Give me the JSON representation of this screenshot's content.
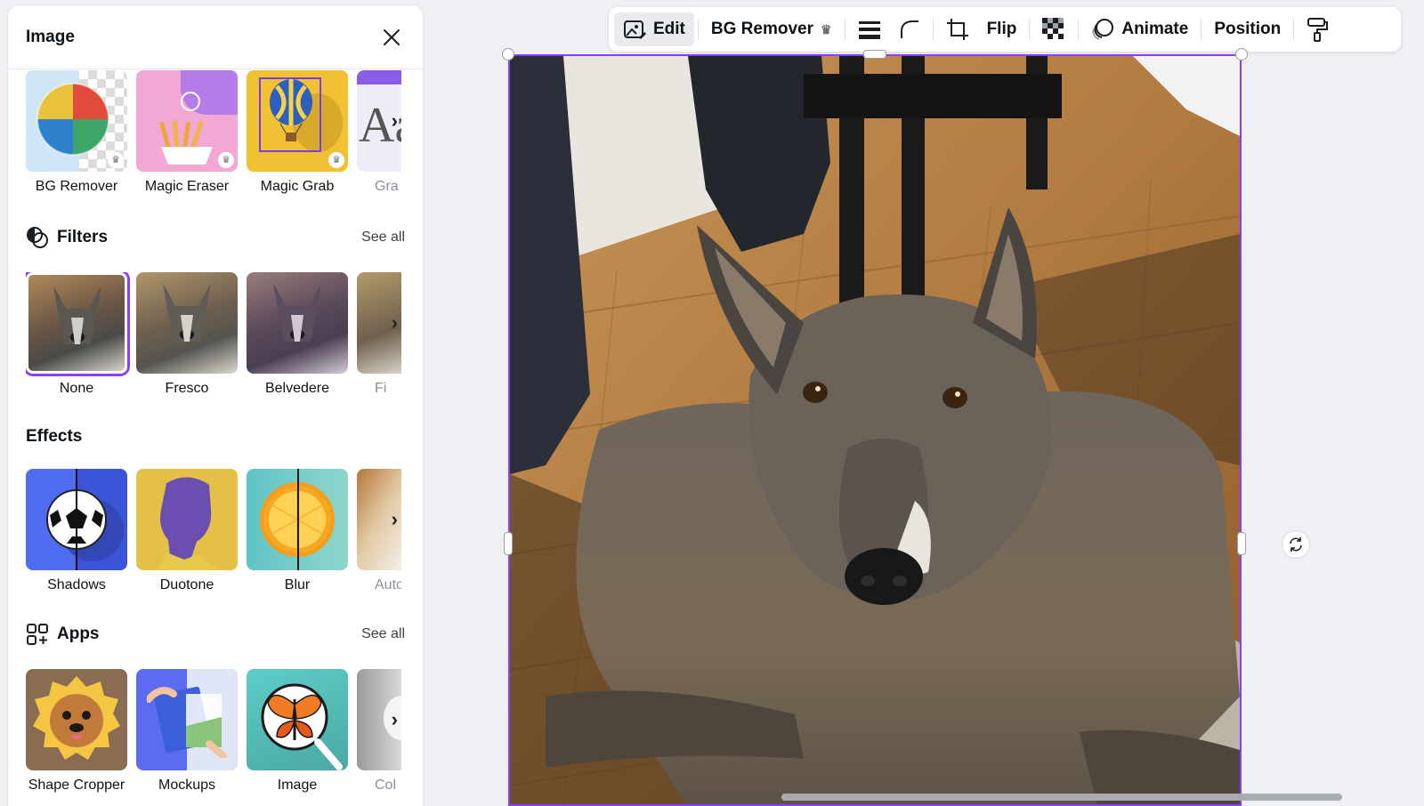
{
  "panel": {
    "title": "Image",
    "tools": {
      "items": [
        {
          "label": "BG Remover"
        },
        {
          "label": "Magic Eraser"
        },
        {
          "label": "Magic Grab"
        },
        {
          "label": "Gra"
        }
      ]
    },
    "filters": {
      "title": "Filters",
      "see_all": "See all",
      "items": [
        {
          "label": "None"
        },
        {
          "label": "Fresco"
        },
        {
          "label": "Belvedere"
        },
        {
          "label": "Fi"
        }
      ]
    },
    "effects": {
      "title": "Effects",
      "items": [
        {
          "label": "Shadows"
        },
        {
          "label": "Duotone"
        },
        {
          "label": "Blur"
        },
        {
          "label": "Auto"
        }
      ]
    },
    "apps": {
      "title": "Apps",
      "see_all": "See all",
      "items": [
        {
          "label": "Shape Cropper"
        },
        {
          "label": "Mockups"
        },
        {
          "label": "Image"
        },
        {
          "label": "Col"
        }
      ]
    }
  },
  "toolbar": {
    "edit": "Edit",
    "bg_remover": "BG Remover",
    "flip": "Flip",
    "animate": "Animate",
    "position": "Position"
  },
  "colors": {
    "accent": "#8b3dff",
    "panel_bg": "#ffffff",
    "canvas_bg": "#eef0f4"
  }
}
